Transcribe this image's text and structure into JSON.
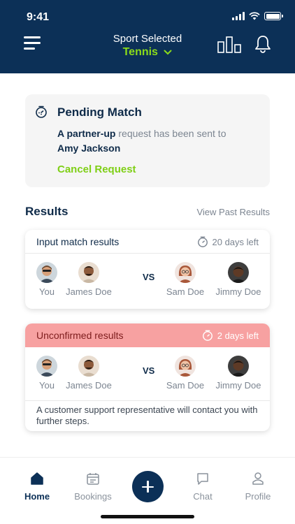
{
  "status_bar": {
    "time": "9:41"
  },
  "header": {
    "sport_label": "Sport Selected",
    "sport_value": "Tennis",
    "accent_color": "#8bdc1a",
    "background_color": "#0c3057",
    "icons": [
      "menu-icon",
      "stats-icon",
      "bell-icon"
    ]
  },
  "pending": {
    "title": "Pending Match",
    "request_type": "A partner-up",
    "message": "request has been sent to",
    "recipient": "Amy Jackson",
    "cancel_label": "Cancel Request"
  },
  "results": {
    "title": "Results",
    "past_link": "View Past Results",
    "cards": [
      {
        "title": "Input match results",
        "days_left": "20 days left",
        "team_a": [
          "You",
          "James Doe"
        ],
        "vs": "VS",
        "team_b": [
          "Sam Doe",
          "Jimmy Doe"
        ]
      },
      {
        "title": "Unconfirmed results",
        "days_left": "2 days left",
        "status_color": "#f7a1a1",
        "team_a": [
          "You",
          "James Doe"
        ],
        "vs": "VS",
        "team_b": [
          "Sam Doe",
          "Jimmy Doe"
        ],
        "note": "A customer support representative will contact you with further steps."
      }
    ]
  },
  "bottom_nav": {
    "items": [
      {
        "label": "Home",
        "icon": "home-icon",
        "active": true
      },
      {
        "label": "Bookings",
        "icon": "calendar-icon",
        "active": false
      },
      {
        "label": "Chat",
        "icon": "chat-icon",
        "active": false
      },
      {
        "label": "Profile",
        "icon": "profile-icon",
        "active": false
      }
    ],
    "add_icon": "plus-icon"
  }
}
